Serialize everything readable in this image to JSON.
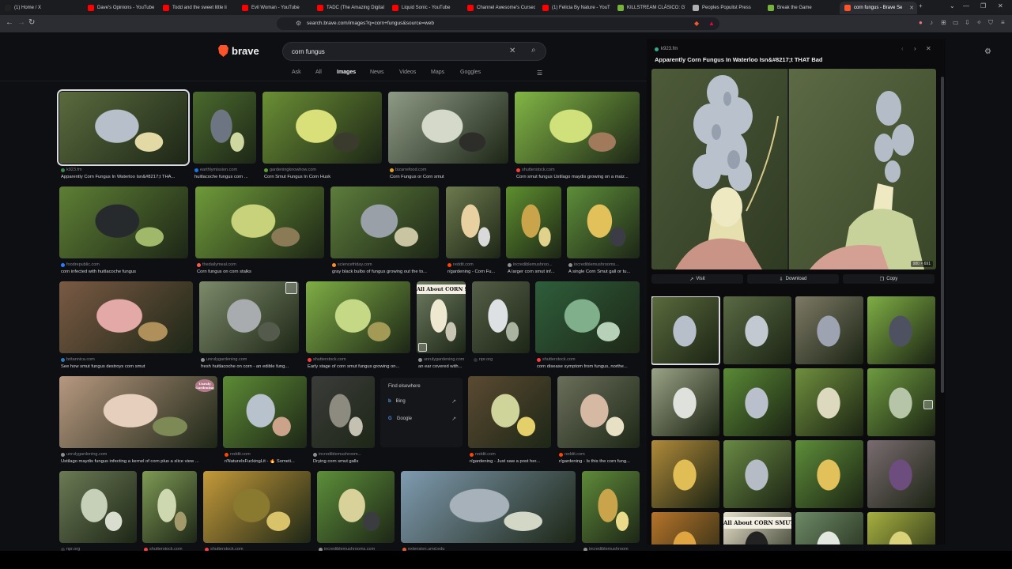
{
  "browser": {
    "tabs": [
      {
        "label": "(1) Home / X",
        "icon": "x-icon",
        "color": "#222222"
      },
      {
        "label": "Dave's Opinions - YouTube",
        "icon": "youtube-icon",
        "color": "#ff0000"
      },
      {
        "label": "Todd and the sweet little li",
        "icon": "youtube-icon",
        "color": "#ff0000"
      },
      {
        "label": "Evil Woman - YouTube",
        "icon": "youtube-icon",
        "color": "#ff0000"
      },
      {
        "label": "TADC (The Amazing Digital",
        "icon": "youtube-icon",
        "color": "#ff0000"
      },
      {
        "label": "Liquid Sonic - YouTube",
        "icon": "youtube-icon",
        "color": "#ff0000"
      },
      {
        "label": "Channel Awesome's Cursed",
        "icon": "youtube-icon",
        "color": "#ff0000"
      },
      {
        "label": "(1) Felicia By Nature - YouT",
        "icon": "youtube-icon",
        "color": "#ff0000"
      },
      {
        "label": "KILLSTREAM CLÁSICO: GTA",
        "icon": "rumble-icon",
        "color": "#76b33a"
      },
      {
        "label": "Peoples Populist Press",
        "icon": "globe-icon",
        "color": "#b0b0b0"
      },
      {
        "label": "Break the Game",
        "icon": "rumble-icon",
        "color": "#76b33a"
      },
      {
        "label": "corn fungus - Brave Se",
        "icon": "brave-icon",
        "color": "#fb542b"
      }
    ],
    "url": "search.brave.com/images?q=corn+fungus&source=web"
  },
  "search": {
    "query": "corn fungus",
    "logo_text": "brave",
    "tabs": [
      "Ask",
      "All",
      "Images",
      "News",
      "Videos",
      "Maps",
      "Goggles"
    ],
    "active_tab": "Images"
  },
  "results": [
    {
      "source": "k923.fm",
      "title": "Apparently Corn Fungus In Waterloo Isn&#8217;t THA..."
    },
    {
      "source": "earthlymission.com",
      "title": "huitlacoche fungus corn ..."
    },
    {
      "source": "gardeningknowhow.com",
      "title": "Corn Smut Fungus In Corn Husk"
    },
    {
      "source": "bizarrefood.com",
      "title": "Corn Fungus or Corn smut"
    },
    {
      "source": "shutterstock.com",
      "title": "Corn smut fungus Ustilago maydis growing on a maiz..."
    },
    {
      "source": "foodrepublic.com",
      "title": "corn infected with huitlacoche fungus"
    },
    {
      "source": "thedailymeal.com",
      "title": "Corn fungus on corn stalks"
    },
    {
      "source": "sciencefriday.com",
      "title": "gray black bulbs of fungus growing out the to..."
    },
    {
      "source": "reddit.com",
      "title": "r/gardening - Corn Fu..."
    },
    {
      "source": "incrediblemushroo...",
      "title": "A larger corn smut inf..."
    },
    {
      "source": "incrediblemushrooms...",
      "title": "A single Corn Smut gall or tu..."
    },
    {
      "source": "britannica.com",
      "title": "See how smut fungus destroys corn smut"
    },
    {
      "source": "unrulygardening.com",
      "title": "fresh huitlacoche on corn - an edible fung..."
    },
    {
      "source": "shutterstock.com",
      "title": "Early stage of corn smut fungus growing on..."
    },
    {
      "source": "unrulygardening.com",
      "title": "an ear covered with..."
    },
    {
      "source": "npr.org",
      "title": ""
    },
    {
      "source": "shutterstock.com",
      "title": "corn disease symptom from fungus, northe..."
    },
    {
      "source": "unrulygardening.com",
      "title": "Ustilago maydis fungus infecting a kernel of corn plus a slice view ..."
    },
    {
      "source": "reddit.com",
      "title": "r/NatureIsFuckingLit - 🔥 Someti..."
    },
    {
      "source": "incrediblemushroom...",
      "title": "Drying corn smut galls"
    },
    {
      "source": "reddit.com",
      "title": "r/gardening - Just saw a post her..."
    },
    {
      "source": "reddit.com",
      "title": "r/gardening - Is this the corn fung..."
    },
    {
      "source": "npr.org",
      "title": ""
    },
    {
      "source": "shutterstock.com",
      "title": ""
    },
    {
      "source": "shutterstock.com",
      "title": ""
    },
    {
      "source": "incrediblemushrooms.com",
      "title": ""
    },
    {
      "source": "extension.umd.edu",
      "title": ""
    },
    {
      "source": "incrediblemushroom",
      "title": ""
    }
  ],
  "find_elsewhere": {
    "title": "Find elsewhere",
    "items": [
      {
        "label": "Bing",
        "icon": "bing-icon"
      },
      {
        "label": "Google",
        "icon": "google-icon"
      }
    ]
  },
  "side_panel": {
    "site": "k923.fm",
    "title": "Apparently Corn Fungus In Waterloo Isn&#8217;t THAT Bad",
    "dimensions": "980 × 691",
    "buttons": {
      "visit": "Visit",
      "download": "Download",
      "copy": "Copy"
    },
    "grid_text": "All About CORN SMUT"
  },
  "overlay_text": {
    "corn_smut_sign": "All About CORN SMUT",
    "script_badge": "Unruly Gardening"
  },
  "colors": {
    "brand": "#fb542b",
    "background": "#0e0f12",
    "panel": "#0b0b0d"
  }
}
